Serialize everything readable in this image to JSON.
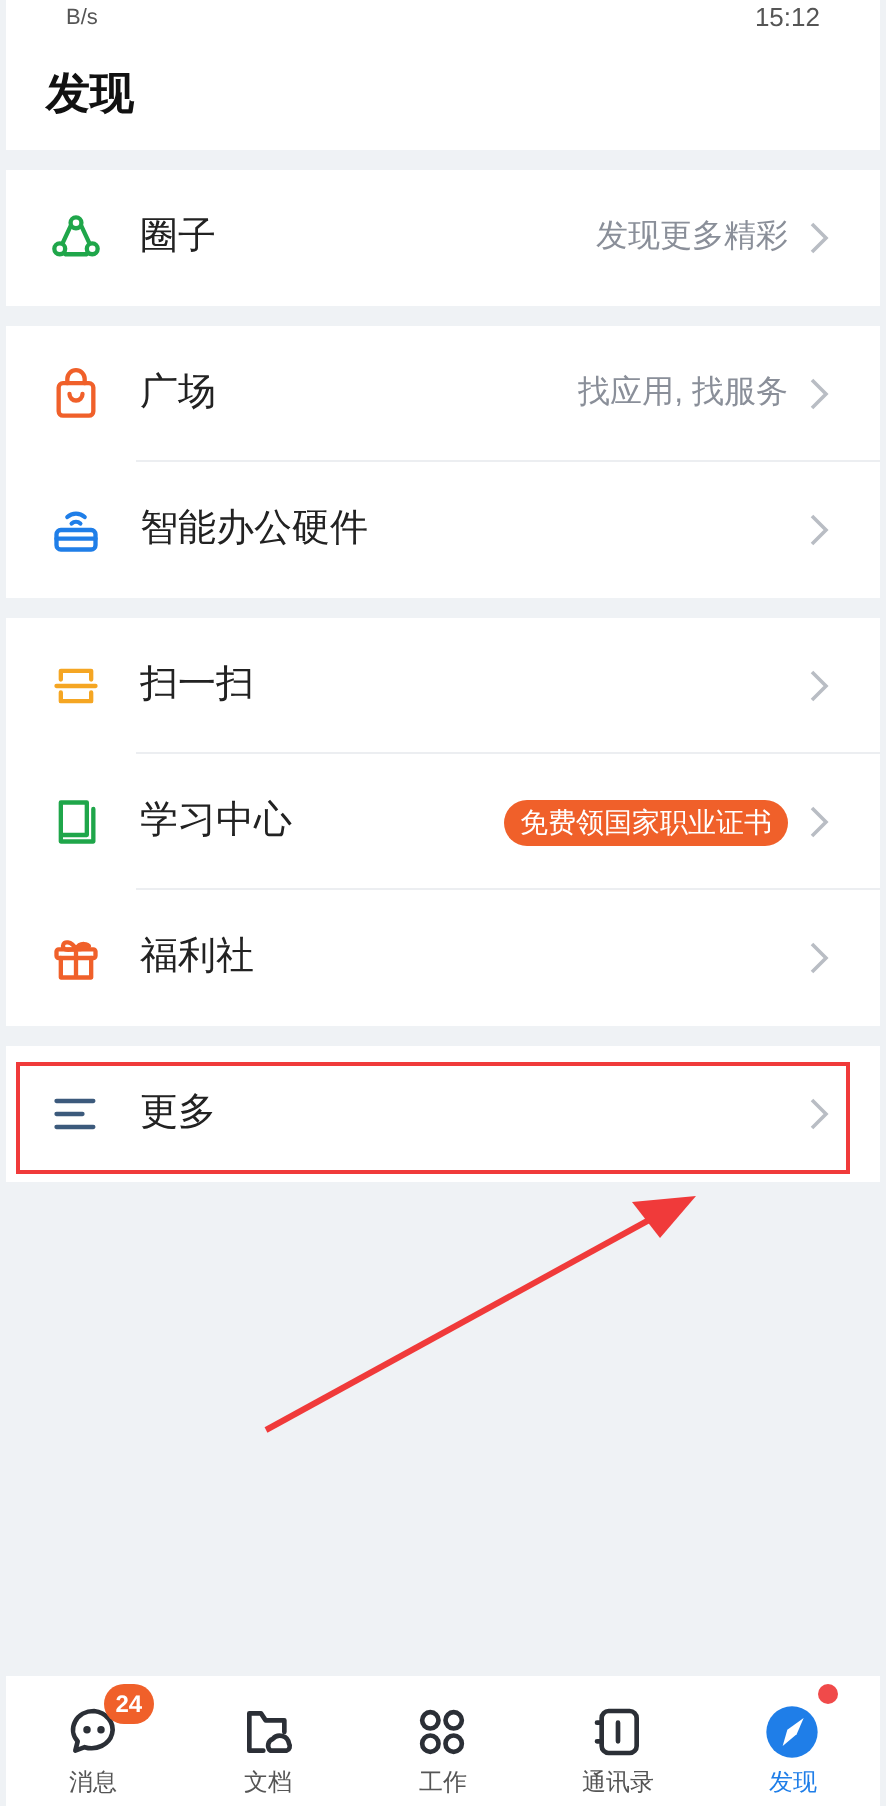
{
  "status_bar": {
    "speed": "B/s",
    "time": "15:12"
  },
  "title": "发现",
  "groups": [
    {
      "items": [
        {
          "kind": "circle",
          "label": "圈子",
          "hint": "发现更多精彩",
          "annotated": false
        }
      ]
    },
    {
      "items": [
        {
          "kind": "bag",
          "label": "广场",
          "hint": "找应用, 找服务",
          "annotated": false
        },
        {
          "kind": "router",
          "label": "智能办公硬件",
          "annotated": false
        }
      ]
    },
    {
      "items": [
        {
          "kind": "scan",
          "label": "扫一扫",
          "annotated": false
        },
        {
          "kind": "book",
          "label": "学习中心",
          "badge": "免费领国家职业证书",
          "annotated": false
        },
        {
          "kind": "gift",
          "label": "福利社",
          "annotated": false
        }
      ]
    },
    {
      "items": [
        {
          "kind": "menu",
          "label": "更多",
          "annotated": true
        }
      ]
    }
  ],
  "tabs": [
    {
      "kind": "chat",
      "label": "消息",
      "selected": false,
      "badge": "24",
      "dot": false
    },
    {
      "kind": "folder",
      "label": "文档",
      "selected": false,
      "dot": false
    },
    {
      "kind": "grid",
      "label": "工作",
      "selected": false,
      "dot": false
    },
    {
      "kind": "contacts",
      "label": "通讯录",
      "selected": false,
      "dot": false
    },
    {
      "kind": "discover",
      "label": "发现",
      "selected": true,
      "dot": true
    }
  ]
}
